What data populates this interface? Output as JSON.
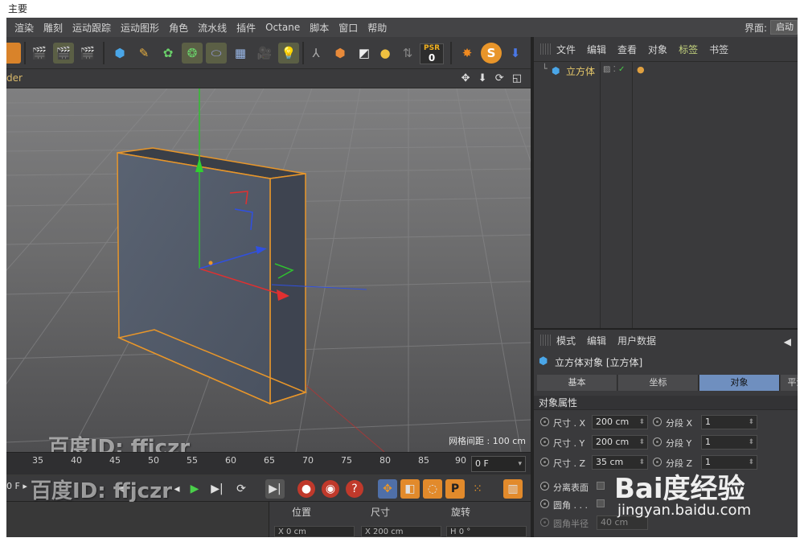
{
  "window": {
    "title": "主要"
  },
  "menu": {
    "items": [
      "渲染",
      "雕刻",
      "运动跟踪",
      "运动图形",
      "角色",
      "流水线",
      "插件",
      "Octane",
      "脚本",
      "窗口",
      "帮助"
    ],
    "layout_label": "界面:",
    "layout_value": "启动"
  },
  "toolbar": {
    "psr_label": "PSR",
    "psr_value": "0"
  },
  "viewport": {
    "label": "der",
    "nav_icons": "✥ ⬇ ⟳ ◱",
    "grid_spacing": "网格间距 : 100 cm"
  },
  "timeline": {
    "ticks": [
      "35",
      "40",
      "45",
      "50",
      "55",
      "60",
      "65",
      "70",
      "75",
      "80",
      "85",
      "90"
    ],
    "frame": "0 F"
  },
  "transport": {
    "range_left": "0 F ▸"
  },
  "coord_panel": {
    "headers": [
      "位置",
      "尺寸",
      "旋转"
    ],
    "fields": [
      "X  0 cm",
      "X  200 cm",
      "H  0 °"
    ]
  },
  "object_manager": {
    "menu": [
      "文件",
      "编辑",
      "查看",
      "对象",
      "标签",
      "书签"
    ],
    "active_menu": "标签",
    "object_name": "立方体"
  },
  "attribute_manager": {
    "menu": [
      "模式",
      "编辑",
      "用户数据"
    ],
    "title": "立方体对象 [立方体]",
    "tabs": [
      "基本",
      "坐标",
      "对象",
      "平滑"
    ],
    "active_tab": "对象",
    "section": "对象属性",
    "size_x_label": "尺寸 . X",
    "size_x": "200 cm",
    "size_y_label": "尺寸 . Y",
    "size_y": "200 cm",
    "size_z_label": "尺寸 . Z",
    "size_z": "35 cm",
    "seg_x_label": "分段 X",
    "seg_x": "1",
    "seg_y_label": "分段 Y",
    "seg_y": "1",
    "seg_z_label": "分段 Z",
    "seg_z": "1",
    "separate_label": "分离表面",
    "fillet_label": "圆角 . . .",
    "fillet_radius_label": "圆角半径",
    "fillet_radius": "40 cm"
  },
  "watermarks": {
    "id_text": "百度ID: ffjczr",
    "logo": "Bai度经验",
    "url": "jingyan.baidu.com"
  },
  "colors": {
    "accent_orange": "#e8962a",
    "active_tab": "#6f8fbf",
    "object_highlight": "#e6c86a",
    "axis_x": "#e03030",
    "axis_y": "#30c030",
    "axis_z": "#3050e0"
  }
}
